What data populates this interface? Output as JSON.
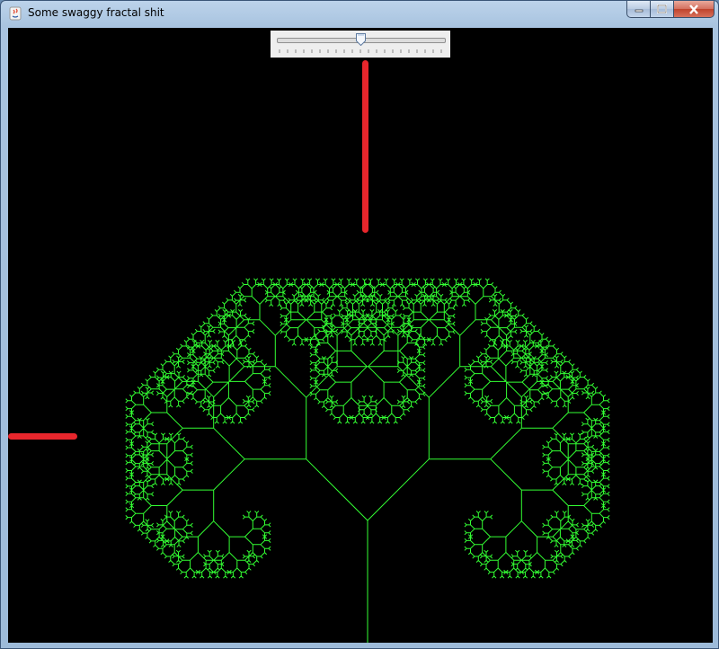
{
  "window": {
    "title": "Some swaggy fractal shit",
    "buttons": {
      "minimize": "minimize-icon",
      "maximize": "maximize-icon",
      "close": "close-icon"
    }
  },
  "slider": {
    "min": 0,
    "max": 100,
    "value": 50,
    "major_ticks": 0,
    "minor_ticks": 20
  },
  "canvas": {
    "background": "#000000",
    "line_color": "#33ff33",
    "marker_color": "#e8262c",
    "fractal": "pythagoras-style binary tree",
    "depth": 12
  }
}
